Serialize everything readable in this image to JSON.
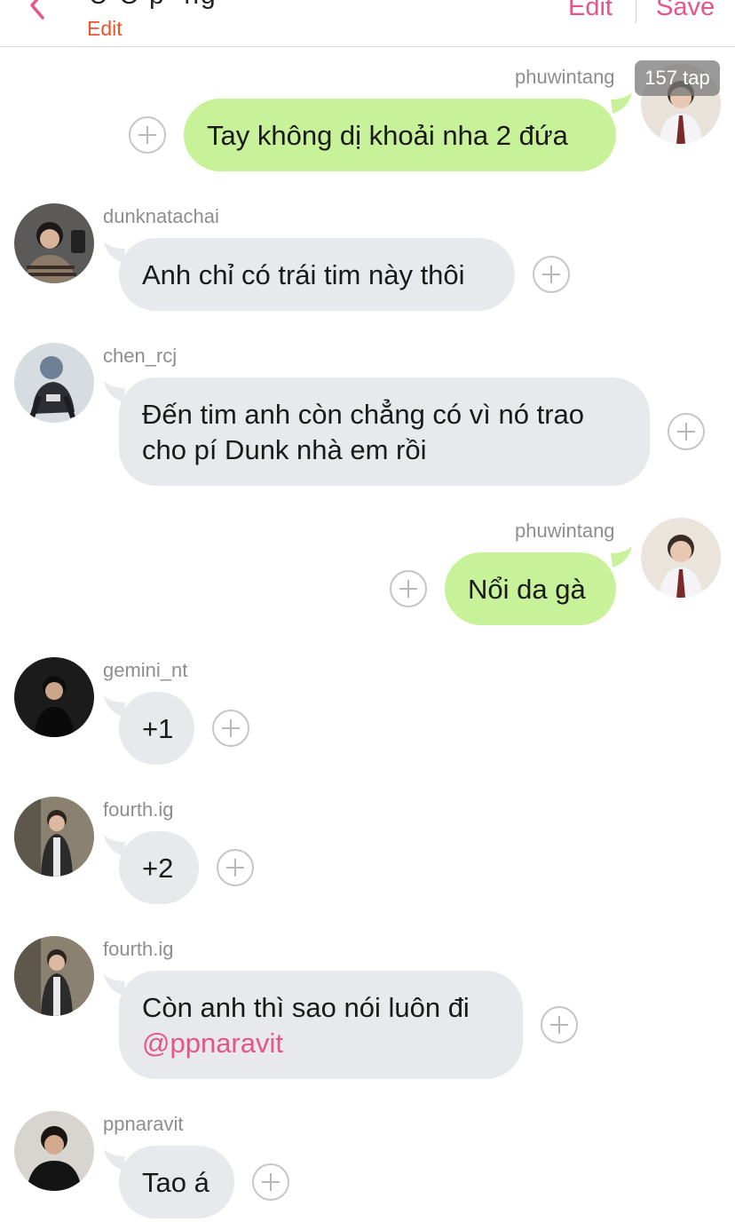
{
  "header": {
    "title_partial": "U C p  ng   ",
    "edit_sub": "Edit",
    "edit": "Edit",
    "save": "Save"
  },
  "tap_badge": "157 tap",
  "messages": [
    {
      "user": "phuwintang",
      "text": "Tay không dị khoải nha 2 đứa",
      "side": "out"
    },
    {
      "user": "dunknatachai",
      "text": "Anh chỉ có trái tim này thôi",
      "side": "in"
    },
    {
      "user": "chen_rcj",
      "line1": "Đến tim anh còn chẳng có vì nó trao",
      "line2": "cho pí Dunk nhà em rồi",
      "side": "in"
    },
    {
      "user": "phuwintang",
      "text": "Nổi da gà",
      "side": "out"
    },
    {
      "user": "gemini_nt",
      "text": "+1",
      "side": "in"
    },
    {
      "user": "fourth.ig",
      "text": "+2",
      "side": "in"
    },
    {
      "user": "fourth.ig",
      "line1": "Còn anh thì sao nói luôn đi",
      "mention": "@ppnaravit",
      "side": "in"
    },
    {
      "user": "ppnaravit",
      "text": "Tao á",
      "side": "in"
    }
  ],
  "colors": {
    "accent": "#e65586",
    "outgoing": "#c8f29a",
    "incoming": "#e7e9ec",
    "edit_orange": "#e8542b"
  }
}
